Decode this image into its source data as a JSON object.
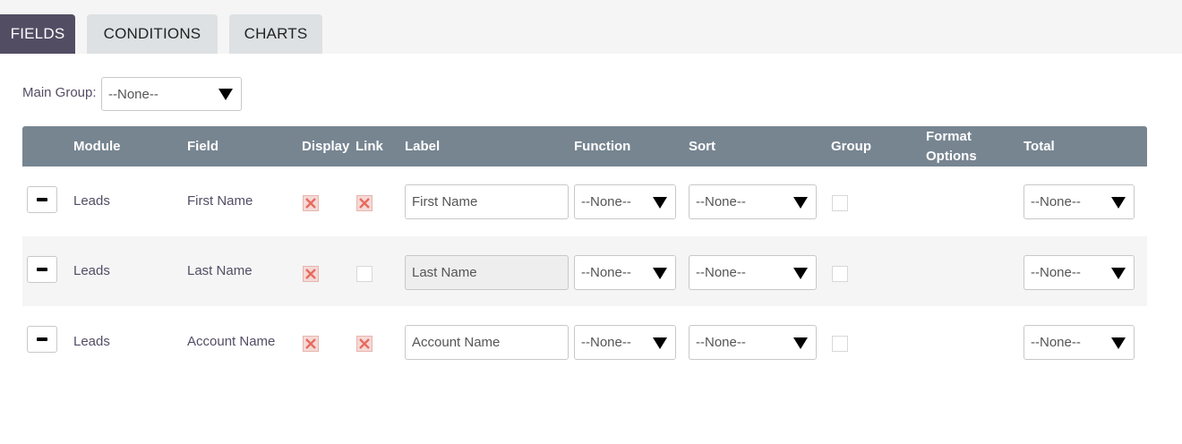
{
  "tabs": [
    {
      "label": "FIELDS",
      "active": true
    },
    {
      "label": "CONDITIONS",
      "active": false
    },
    {
      "label": "CHARTS",
      "active": false
    }
  ],
  "main_group": {
    "label": "Main Group:",
    "value": "--None--"
  },
  "table": {
    "headers": {
      "module": "Module",
      "field": "Field",
      "display": "Display",
      "link": "Link",
      "label": "Label",
      "function": "Function",
      "sort": "Sort",
      "group": "Group",
      "format_options": "Format Options",
      "total": "Total"
    },
    "rows": [
      {
        "module": "Leads",
        "field": "First Name",
        "display": true,
        "link": true,
        "label": "First Name",
        "function": "--None--",
        "sort": "--None--",
        "group": false,
        "total": "--None--"
      },
      {
        "module": "Leads",
        "field": "Last Name",
        "display": true,
        "link": false,
        "label": "Last Name",
        "function": "--None--",
        "sort": "--None--",
        "group": false,
        "total": "--None--"
      },
      {
        "module": "Leads",
        "field": "Account Name",
        "display": true,
        "link": true,
        "label": "Account Name",
        "function": "--None--",
        "sort": "--None--",
        "group": false,
        "total": "--None--"
      }
    ]
  },
  "colors": {
    "active_tab": "#534d64",
    "inactive_tab": "#dde1e4",
    "header_bg": "#778591",
    "checked_mark": "#e86a5f"
  },
  "icons": {
    "remove": "minus-icon",
    "checked": "x-mark-icon",
    "dropdown": "triangle-down-icon"
  }
}
